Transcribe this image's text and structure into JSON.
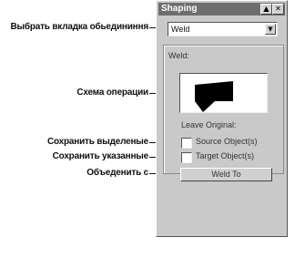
{
  "annotations": {
    "select_tab": "Выбрать вкладка обьедининня",
    "operation_scheme": "Схема операции",
    "keep_selected": "Сохранить выделеные",
    "keep_specified": "Сохранить указанные",
    "combine_with": "Объеденить с"
  },
  "window": {
    "title": "Shaping",
    "help_button": "▲",
    "close_button": "✕"
  },
  "operation_select": {
    "value": "Weld",
    "arrow": "▼"
  },
  "group": {
    "operation_label": "Weld:",
    "leave_original_label": "Leave Original:"
  },
  "checkboxes": {
    "source_label": "Source Object(s)",
    "source_checked": false,
    "target_label": "Target Object(s)",
    "target_checked": false
  },
  "apply_button": {
    "label": "Weld To"
  }
}
